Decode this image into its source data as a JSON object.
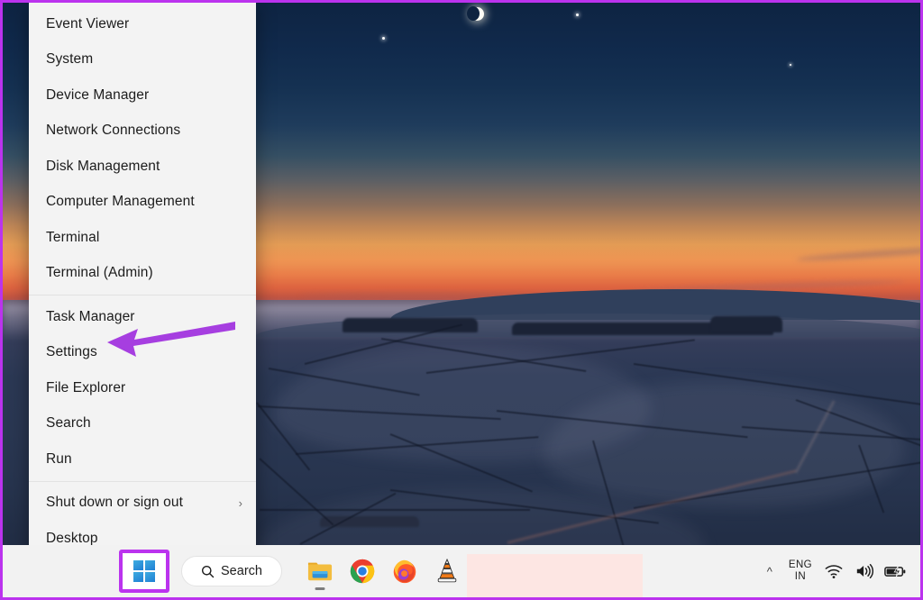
{
  "screen": {
    "accent_border_color": "#bb33ee",
    "wallpaper_description": "winter-sunset-landscape"
  },
  "winx_menu": {
    "name": "power-user-menu",
    "groups": [
      {
        "items": [
          {
            "label": "Event Viewer",
            "has_submenu": false
          },
          {
            "label": "System",
            "has_submenu": false
          },
          {
            "label": "Device Manager",
            "has_submenu": false
          },
          {
            "label": "Network Connections",
            "has_submenu": false
          },
          {
            "label": "Disk Management",
            "has_submenu": false
          },
          {
            "label": "Computer Management",
            "has_submenu": false
          },
          {
            "label": "Terminal",
            "has_submenu": false
          },
          {
            "label": "Terminal (Admin)",
            "has_submenu": false
          }
        ]
      },
      {
        "items": [
          {
            "label": "Task Manager",
            "has_submenu": false
          },
          {
            "label": "Settings",
            "has_submenu": false
          },
          {
            "label": "File Explorer",
            "has_submenu": false
          },
          {
            "label": "Search",
            "has_submenu": false
          },
          {
            "label": "Run",
            "has_submenu": false
          }
        ]
      },
      {
        "items": [
          {
            "label": "Shut down or sign out",
            "has_submenu": true,
            "chevron": "›"
          },
          {
            "label": "Desktop",
            "has_submenu": false
          }
        ]
      }
    ]
  },
  "annotation": {
    "arrow_color": "#a63ee0",
    "points_to": "Settings"
  },
  "taskbar": {
    "start_button": {
      "icon": "windows-logo-icon",
      "highlighted": true,
      "highlight_color": "#bb33ee"
    },
    "search": {
      "label": "Search",
      "icon": "search-icon"
    },
    "pinned_apps": [
      {
        "name": "file-explorer",
        "icon": "folder-icon",
        "running": true
      },
      {
        "name": "google-chrome",
        "icon": "chrome-icon",
        "running": false
      },
      {
        "name": "mozilla-firefox",
        "icon": "firefox-icon",
        "running": false
      },
      {
        "name": "vlc-media-player",
        "icon": "traffic-cone-icon",
        "running": false
      }
    ],
    "redaction": {
      "color": "#fde6e3"
    },
    "tray": {
      "overflow_icon": "chevron-up-icon",
      "language": {
        "line1": "ENG",
        "line2": "IN"
      },
      "icons": [
        {
          "name": "wifi-icon"
        },
        {
          "name": "volume-icon"
        },
        {
          "name": "battery-charging-icon"
        }
      ]
    }
  }
}
